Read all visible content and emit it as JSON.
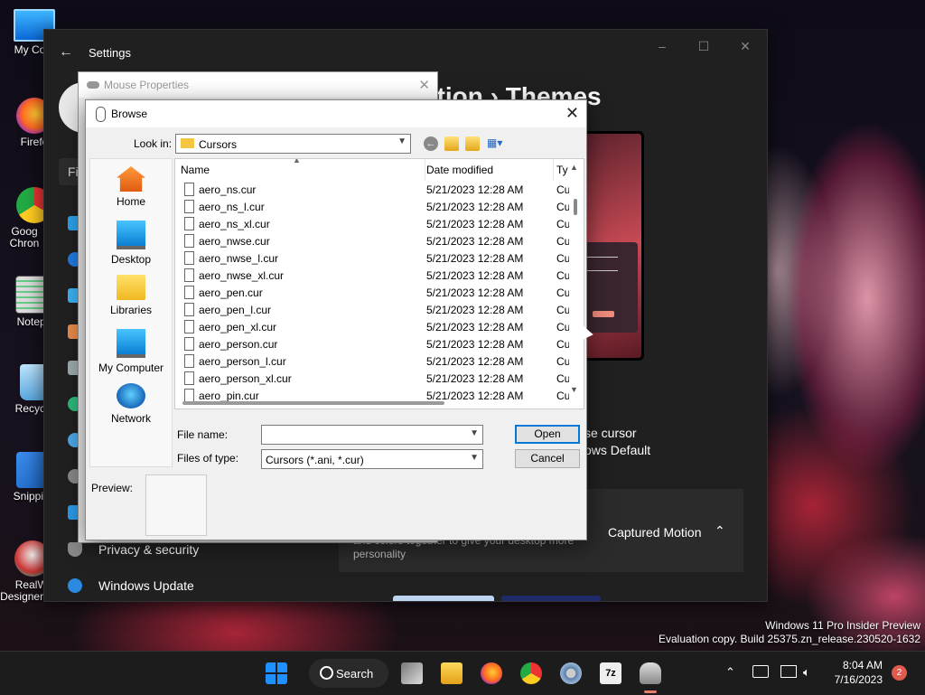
{
  "desktop": {
    "icons": [
      {
        "label": "My Com"
      },
      {
        "label": "Firefo"
      },
      {
        "label": "Goog Chron"
      },
      {
        "label": "Notepa"
      },
      {
        "label": "Recycle"
      },
      {
        "label": "Snipping"
      },
      {
        "label": "RealWo Designer Web"
      }
    ]
  },
  "settings": {
    "title": "Settings",
    "heading": "zation  ›  Themes",
    "search_stub": "Fi",
    "nav": [
      {
        "label": "Privacy & security"
      },
      {
        "label": "Windows Update"
      }
    ],
    "cursor_line1": "se cursor",
    "cursor_line2": "ows Default",
    "theme_desc": "and colors together to give your desktop more personality",
    "theme_name": "Captured Motion",
    "colors": {
      "accent_preview": "#c84a55",
      "panel": "#2b2b2b"
    }
  },
  "mouse_properties": {
    "title": "Mouse Properties"
  },
  "browse": {
    "title": "Browse",
    "look_in_label": "Look in:",
    "look_in_value": "Cursors",
    "places": [
      {
        "label": "Home"
      },
      {
        "label": "Desktop"
      },
      {
        "label": "Libraries"
      },
      {
        "label": "My Computer"
      },
      {
        "label": "Network"
      }
    ],
    "columns": {
      "name": "Name",
      "date": "Date modified",
      "type": "Ty"
    },
    "files": [
      {
        "name": "aero_ns.cur",
        "date": "5/21/2023 12:28 AM",
        "type": "Cu"
      },
      {
        "name": "aero_ns_l.cur",
        "date": "5/21/2023 12:28 AM",
        "type": "Cu"
      },
      {
        "name": "aero_ns_xl.cur",
        "date": "5/21/2023 12:28 AM",
        "type": "Cu"
      },
      {
        "name": "aero_nwse.cur",
        "date": "5/21/2023 12:28 AM",
        "type": "Cu"
      },
      {
        "name": "aero_nwse_l.cur",
        "date": "5/21/2023 12:28 AM",
        "type": "Cu"
      },
      {
        "name": "aero_nwse_xl.cur",
        "date": "5/21/2023 12:28 AM",
        "type": "Cu"
      },
      {
        "name": "aero_pen.cur",
        "date": "5/21/2023 12:28 AM",
        "type": "Cu"
      },
      {
        "name": "aero_pen_l.cur",
        "date": "5/21/2023 12:28 AM",
        "type": "Cu"
      },
      {
        "name": "aero_pen_xl.cur",
        "date": "5/21/2023 12:28 AM",
        "type": "Cu"
      },
      {
        "name": "aero_person.cur",
        "date": "5/21/2023 12:28 AM",
        "type": "Cu"
      },
      {
        "name": "aero_person_l.cur",
        "date": "5/21/2023 12:28 AM",
        "type": "Cu"
      },
      {
        "name": "aero_person_xl.cur",
        "date": "5/21/2023 12:28 AM",
        "type": "Cu"
      },
      {
        "name": "aero_pin.cur",
        "date": "5/21/2023 12:28 AM",
        "type": "Cu"
      }
    ],
    "file_name_label": "File name:",
    "file_name_value": "",
    "files_of_type_label": "Files of type:",
    "files_of_type_value": "Cursors (*.ani, *.cur)",
    "open_label": "Open",
    "cancel_label": "Cancel",
    "preview_label": "Preview:"
  },
  "watermark": {
    "line1": "Windows 11 Pro Insider Preview",
    "line2": "Evaluation copy. Build 25375.zn_release.230520-1632"
  },
  "taskbar": {
    "search_label": "Search",
    "sevenzip_label": "7z",
    "time": "8:04 AM",
    "date": "7/16/2023",
    "notifications": "2"
  }
}
